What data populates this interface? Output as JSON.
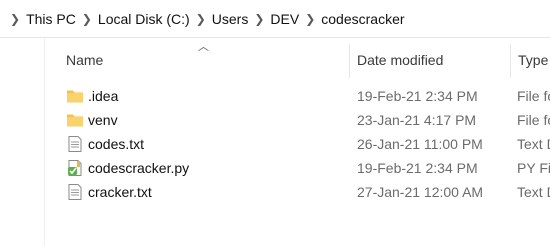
{
  "breadcrumb": [
    "This PC",
    "Local Disk (C:)",
    "Users",
    "DEV",
    "codescracker"
  ],
  "columns": {
    "name": "Name",
    "date": "Date modified",
    "type": "Type"
  },
  "files": [
    {
      "name": ".idea",
      "date": "19-Feb-21 2:34 PM",
      "type": "File fo",
      "icon": "folder-icon"
    },
    {
      "name": "venv",
      "date": "23-Jan-21 4:17 PM",
      "type": "File fo",
      "icon": "folder-icon"
    },
    {
      "name": "codes.txt",
      "date": "26-Jan-21 11:00 PM",
      "type": "Text D",
      "icon": "text-file-icon"
    },
    {
      "name": "codescracker.py",
      "date": "19-Feb-21 2:34 PM",
      "type": "PY Fil",
      "icon": "python-file-icon"
    },
    {
      "name": "cracker.txt",
      "date": "27-Jan-21 12:00 AM",
      "type": "Text D",
      "icon": "text-file-icon"
    }
  ],
  "colors": {
    "folder": "#f3c24e",
    "text": "#6b6b6b"
  }
}
